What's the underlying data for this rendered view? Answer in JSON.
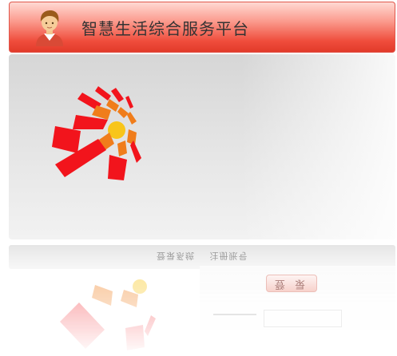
{
  "header": {
    "title": "智慧生活综合服务平台",
    "avatar_icon": "user-avatar-icon"
  },
  "logo": {
    "icon": "sunburst-logo-icon",
    "colors": {
      "red": "#f2141c",
      "orange": "#f07d1b",
      "yellow": "#f8c51a"
    }
  },
  "reflection": {
    "link_left": "登录系统",
    "link_right": "注册账号",
    "button_label": "登 录"
  },
  "colors": {
    "header_top": "#ffd9d3",
    "header_bottom": "#e23a2a",
    "title_text": "#333333",
    "panel_bg": "#e6e6e6"
  }
}
